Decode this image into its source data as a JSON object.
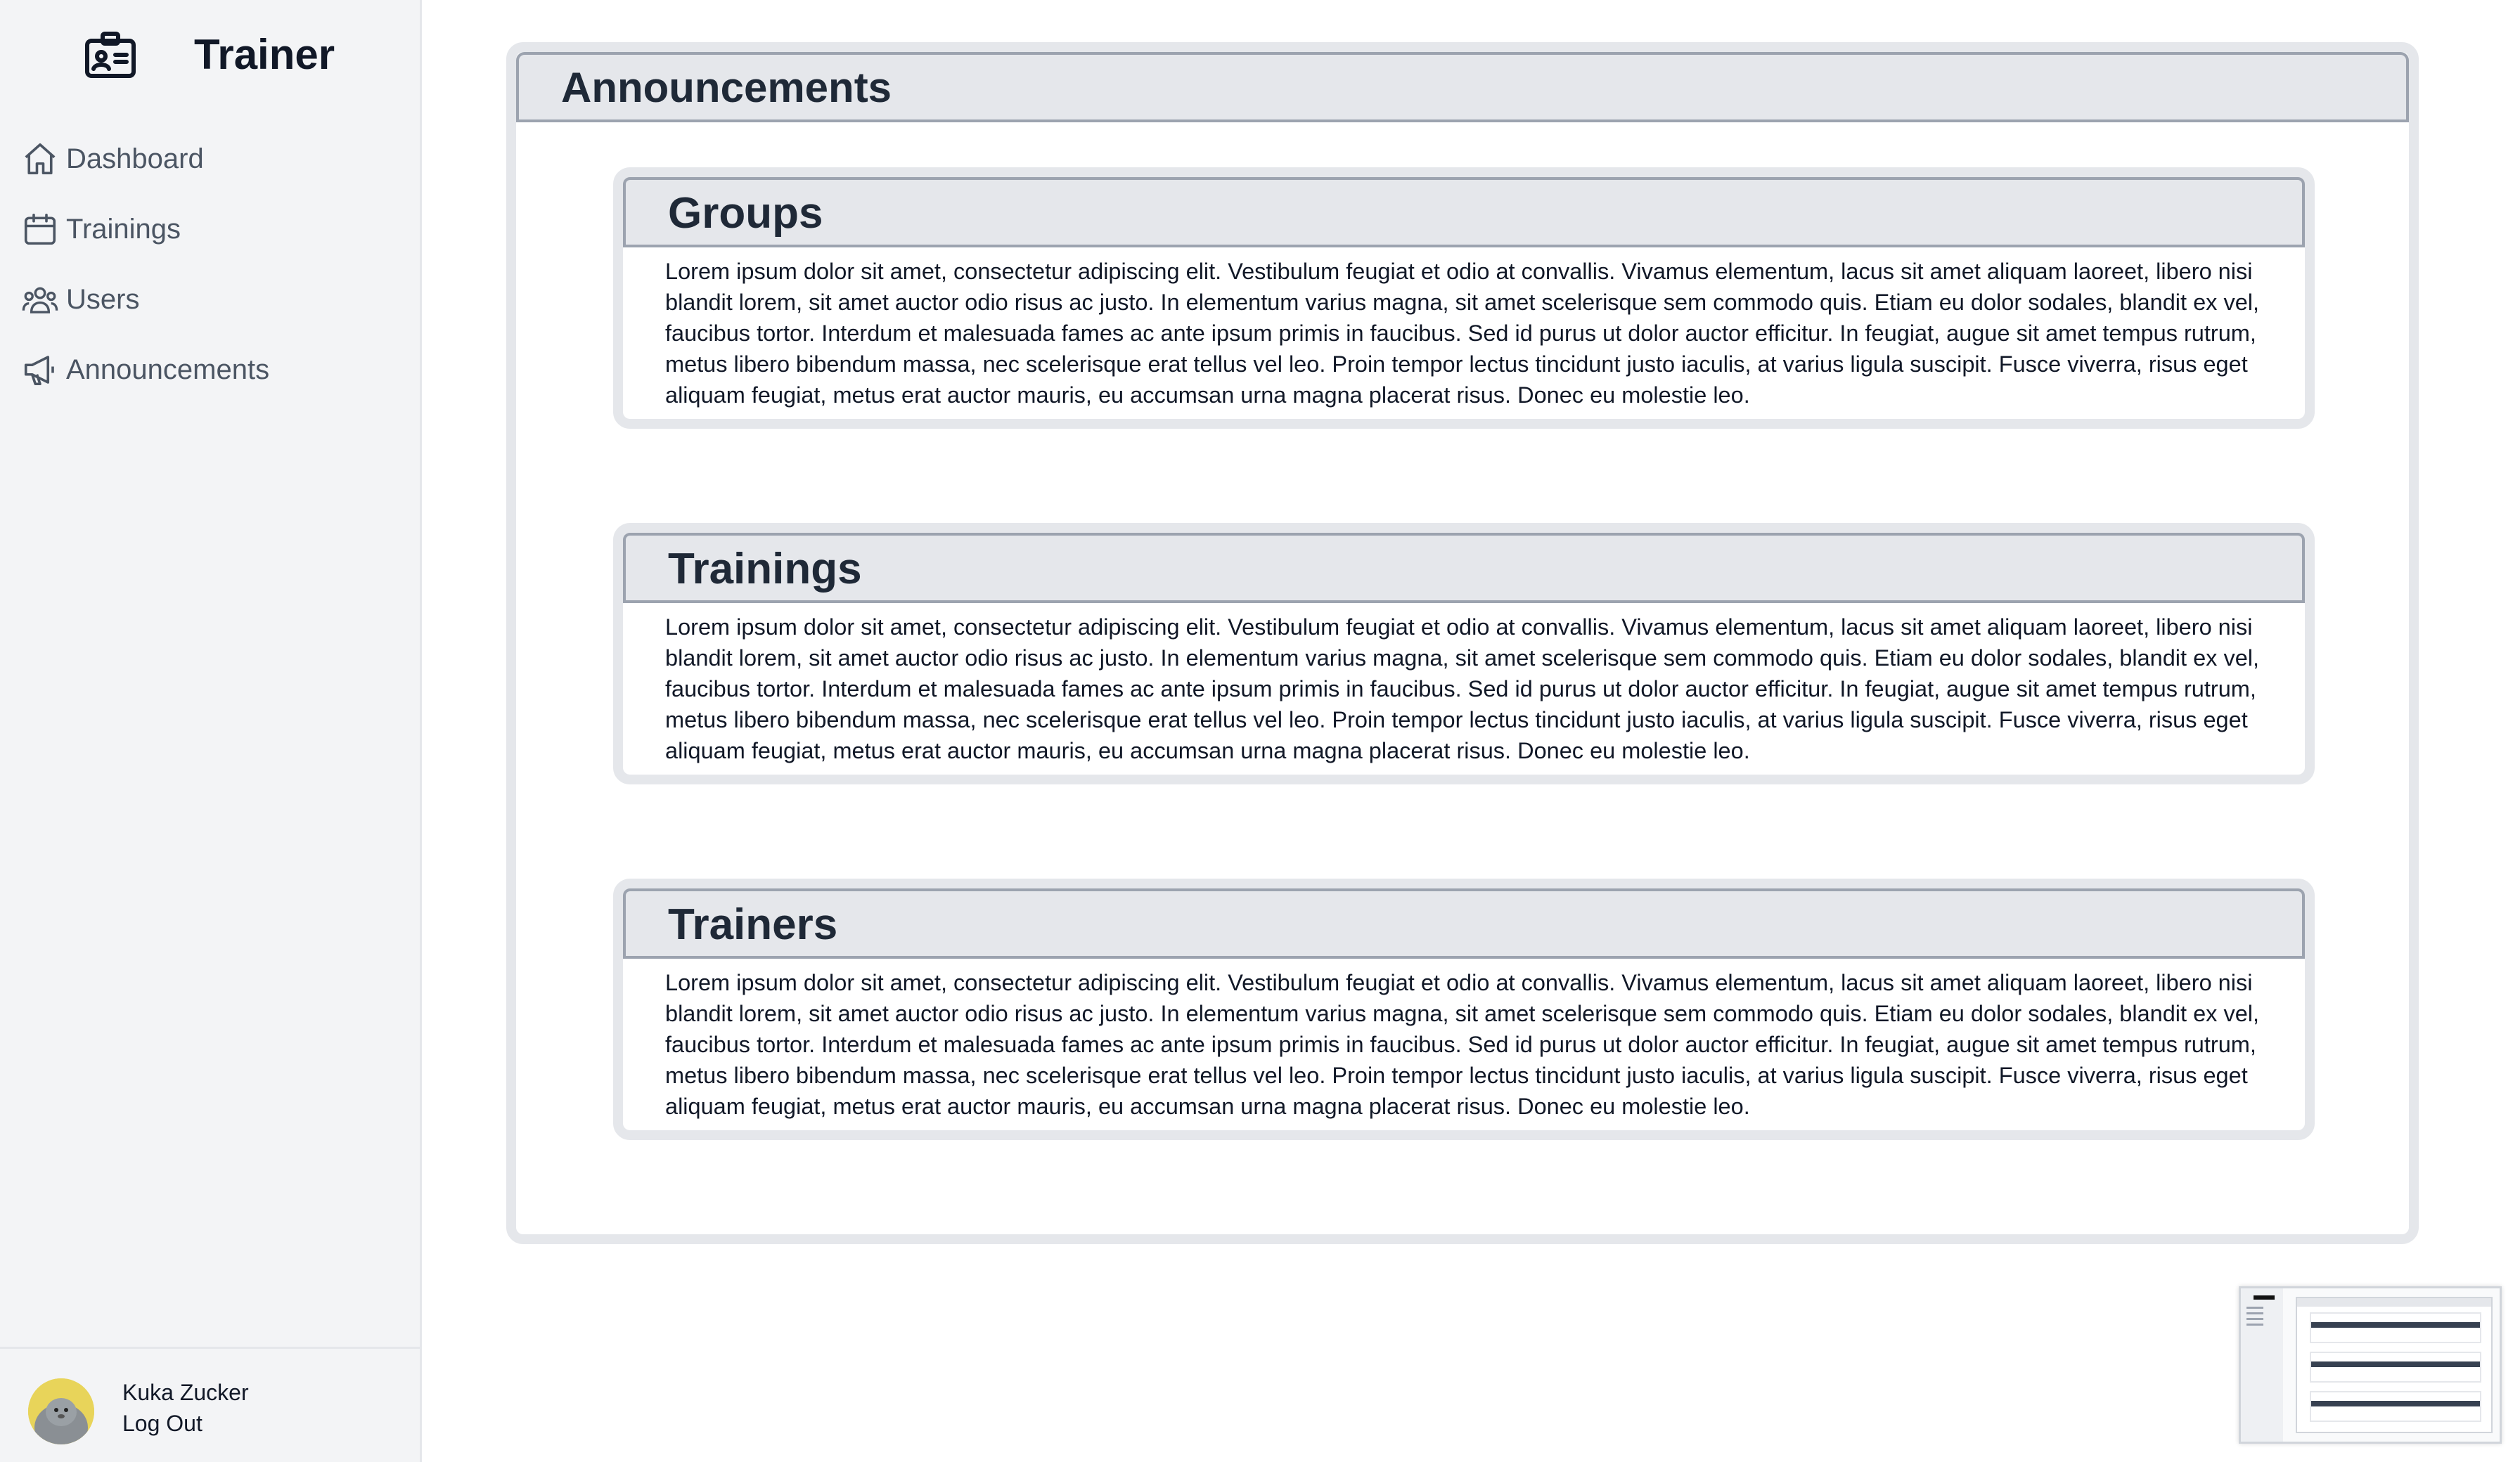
{
  "app": {
    "title": "Trainer"
  },
  "sidebar": {
    "items": [
      {
        "label": "Dashboard",
        "icon": "home-icon"
      },
      {
        "label": "Trainings",
        "icon": "calendar-icon"
      },
      {
        "label": "Users",
        "icon": "users-icon"
      },
      {
        "label": "Announcements",
        "icon": "megaphone-icon"
      }
    ],
    "user": {
      "name": "Kuka Zucker",
      "logout_label": "Log Out"
    }
  },
  "main": {
    "title": "Announcements",
    "cards": [
      {
        "title": "Groups",
        "body": "Lorem ipsum dolor sit amet, consectetur adipiscing elit. Vestibulum feugiat et odio at convallis. Vivamus elementum, lacus sit amet aliquam laoreet, libero nisi blandit lorem, sit amet auctor odio risus ac justo. In elementum varius magna, sit amet scelerisque sem commodo quis. Etiam eu dolor sodales, blandit ex vel, faucibus tortor. Interdum et malesuada fames ac ante ipsum primis in faucibus. Sed id purus ut dolor auctor efficitur. In feugiat, augue sit amet tempus rutrum, metus libero bibendum massa, nec scelerisque erat tellus vel leo. Proin tempor lectus tincidunt justo iaculis, at varius ligula suscipit. Fusce viverra, risus eget aliquam feugiat, metus erat auctor mauris, eu accumsan urna magna placerat risus. Donec eu molestie leo."
      },
      {
        "title": "Trainings",
        "body": "Lorem ipsum dolor sit amet, consectetur adipiscing elit. Vestibulum feugiat et odio at convallis. Vivamus elementum, lacus sit amet aliquam laoreet, libero nisi blandit lorem, sit amet auctor odio risus ac justo. In elementum varius magna, sit amet scelerisque sem commodo quis. Etiam eu dolor sodales, blandit ex vel, faucibus tortor. Interdum et malesuada fames ac ante ipsum primis in faucibus. Sed id purus ut dolor auctor efficitur. In feugiat, augue sit amet tempus rutrum, metus libero bibendum massa, nec scelerisque erat tellus vel leo. Proin tempor lectus tincidunt justo iaculis, at varius ligula suscipit. Fusce viverra, risus eget aliquam feugiat, metus erat auctor mauris, eu accumsan urna magna placerat risus. Donec eu molestie leo."
      },
      {
        "title": "Trainers",
        "body": "Lorem ipsum dolor sit amet, consectetur adipiscing elit. Vestibulum feugiat et odio at convallis. Vivamus elementum, lacus sit amet aliquam laoreet, libero nisi blandit lorem, sit amet auctor odio risus ac justo. In elementum varius magna, sit amet scelerisque sem commodo quis. Etiam eu dolor sodales, blandit ex vel, faucibus tortor. Interdum et malesuada fames ac ante ipsum primis in faucibus. Sed id purus ut dolor auctor efficitur. In feugiat, augue sit amet tempus rutrum, metus libero bibendum massa, nec scelerisque erat tellus vel leo. Proin tempor lectus tincidunt justo iaculis, at varius ligula suscipit. Fusce viverra, risus eget aliquam feugiat, metus erat auctor mauris, eu accumsan urna magna placerat risus. Donec eu molestie leo."
      }
    ]
  },
  "colors": {
    "sidebar_bg": "#f3f4f6",
    "header_bg": "#e5e7eb",
    "header_border": "#9ca3af",
    "nav_text": "#4b5563"
  }
}
